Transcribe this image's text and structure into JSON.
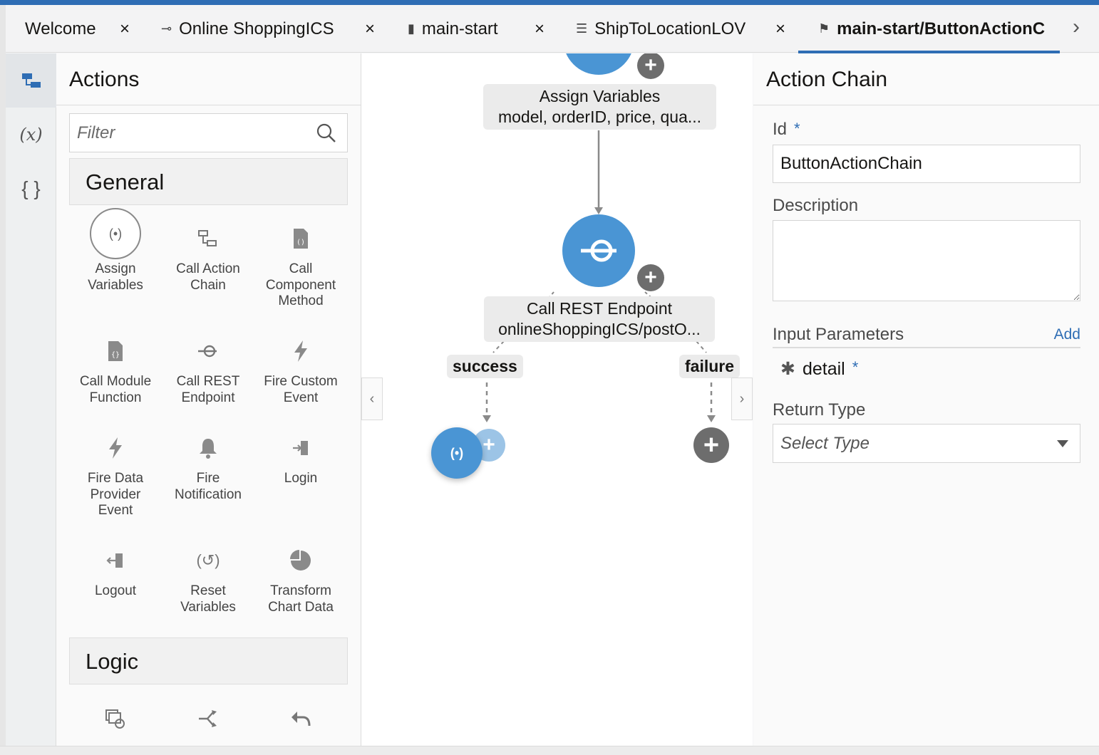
{
  "tabs": [
    {
      "label": "Welcome",
      "icon": "none"
    },
    {
      "label": "Online ShoppingICS",
      "icon": "rest-endpoint-icon"
    },
    {
      "label": "main-start",
      "icon": "file-icon"
    },
    {
      "label": "ShipToLocationLOV",
      "icon": "database-icon"
    },
    {
      "label": "main-start/ButtonActionC",
      "icon": "flag-icon",
      "active": true
    }
  ],
  "rail": {
    "items": [
      "actions-icon",
      "variables-icon",
      "json-icon"
    ],
    "variables_glyph": "(x)",
    "json_glyph": "{ }"
  },
  "actions_panel": {
    "title": "Actions",
    "filter_placeholder": "Filter",
    "general_label": "General",
    "logic_label": "Logic",
    "general_items": [
      {
        "label": "Assign\nVariables",
        "icon": "assign-variables-icon",
        "glyph": "(•)"
      },
      {
        "label": "Call Action\nChain",
        "icon": "action-chain-icon",
        "glyph": "⧉"
      },
      {
        "label": "Call\nComponent\nMethod",
        "icon": "component-method-icon",
        "glyph": "▤"
      },
      {
        "label": "Call Module\nFunction",
        "icon": "module-function-icon",
        "glyph": "▤"
      },
      {
        "label": "Call REST\nEndpoint",
        "icon": "rest-endpoint-icon",
        "glyph": "⊸"
      },
      {
        "label": "Fire Custom\nEvent",
        "icon": "lightning-icon",
        "glyph": "⚡"
      },
      {
        "label": "Fire Data\nProvider\nEvent",
        "icon": "lightning-icon",
        "glyph": "⚡"
      },
      {
        "label": "Fire\nNotification",
        "icon": "bell-icon",
        "glyph": "🔔"
      },
      {
        "label": "Login",
        "icon": "login-icon",
        "glyph": "⇥"
      },
      {
        "label": "Logout",
        "icon": "logout-icon",
        "glyph": "⇤"
      },
      {
        "label": "Reset\nVariables",
        "icon": "reset-variables-icon",
        "glyph": "(↺)"
      },
      {
        "label": "Transform\nChart Data",
        "icon": "pie-chart-icon",
        "glyph": "◕"
      }
    ],
    "logic_items": [
      {
        "icon": "for-each-icon",
        "glyph": "⧉"
      },
      {
        "icon": "if-icon",
        "glyph": "⇉"
      },
      {
        "icon": "return-icon",
        "glyph": "↶"
      }
    ]
  },
  "canvas": {
    "assign_label_1": "Assign Variables",
    "assign_label_2": "model, orderID, price, qua...",
    "rest_label_1": "Call REST Endpoint",
    "rest_label_2": "onlineShoppingICS/postO...",
    "success_label": "success",
    "failure_label": "failure",
    "assign_glyph": "(•)",
    "plus_glyph": "+",
    "node_color": "#4a95d4"
  },
  "properties": {
    "title": "Action Chain",
    "id_label": "Id",
    "required_mark": "*",
    "id_value": "ButtonActionChain",
    "description_label": "Description",
    "description_value": "",
    "input_params_label": "Input Parameters",
    "add_label": "Add",
    "param_name": "detail",
    "param_marker": "✱",
    "return_type_label": "Return Type",
    "return_type_placeholder": "Select Type"
  }
}
